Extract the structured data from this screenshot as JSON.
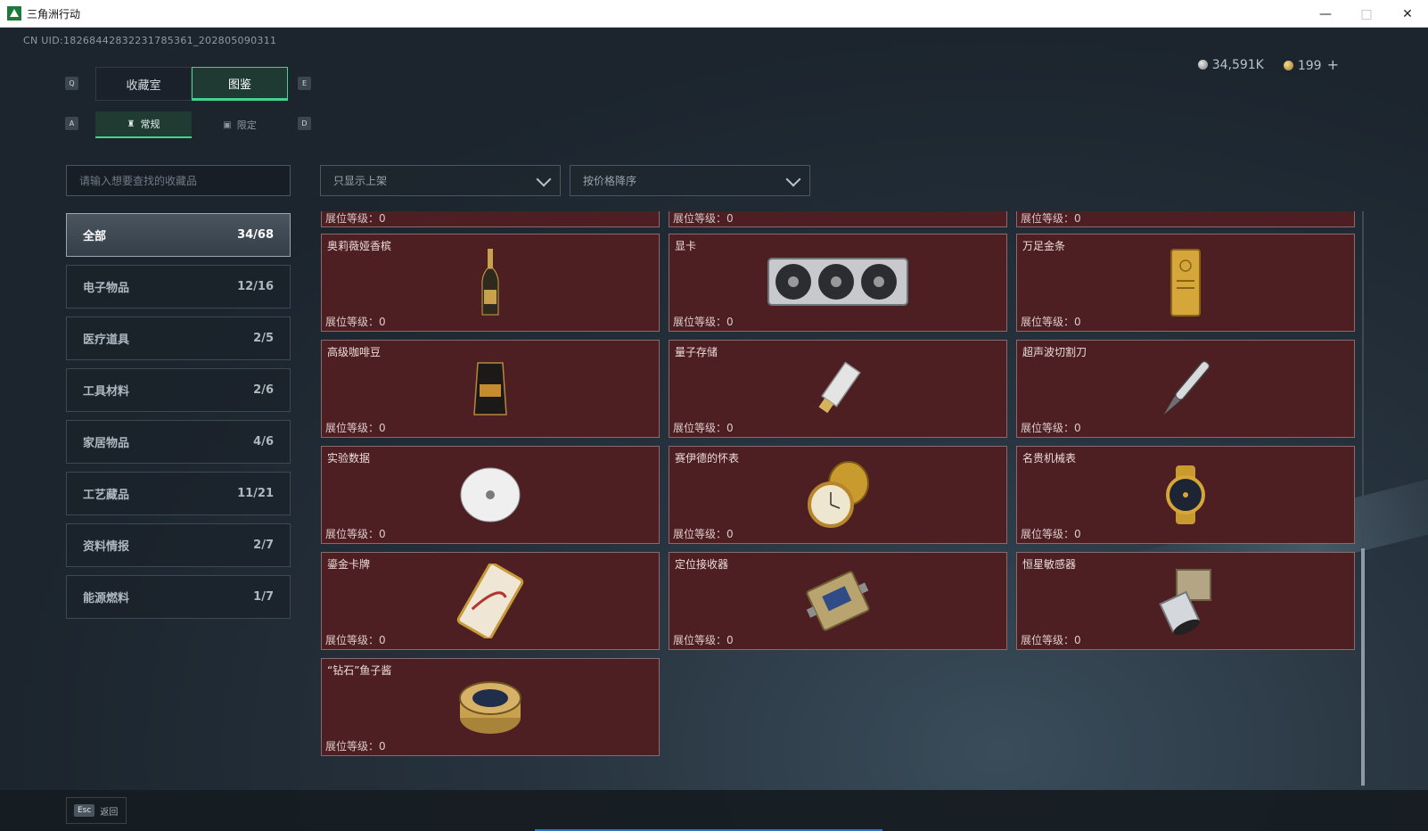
{
  "window": {
    "title": "三角洲行动",
    "minimize": "—",
    "maximize": "□",
    "close": "✕"
  },
  "uid": "CN UID:18268442832231785361_202805090311",
  "currency": {
    "silver": "34,591K",
    "gold": "199",
    "add": "+"
  },
  "keys": {
    "q": "Q",
    "e": "E",
    "a": "A",
    "d": "D"
  },
  "tabs": [
    {
      "label": "收藏室",
      "active": false
    },
    {
      "label": "图鉴",
      "active": true
    }
  ],
  "subtabs": [
    {
      "label": "常规",
      "active": true
    },
    {
      "label": "限定",
      "active": false
    }
  ],
  "search": {
    "placeholder": "请输入想要查找的收藏品"
  },
  "filters": {
    "show": "只显示上架",
    "sort": "按价格降序"
  },
  "categories": [
    {
      "label": "全部",
      "count": "34/68",
      "active": true
    },
    {
      "label": "电子物品",
      "count": "12/16"
    },
    {
      "label": "医疗道具",
      "count": "2/5"
    },
    {
      "label": "工具材料",
      "count": "2/6"
    },
    {
      "label": "家居物品",
      "count": "4/6"
    },
    {
      "label": "工艺藏品",
      "count": "11/21"
    },
    {
      "label": "资料情报",
      "count": "2/7"
    },
    {
      "label": "能源燃料",
      "count": "1/7"
    }
  ],
  "level_label": "展位等级：0",
  "items": [
    {
      "name": "奥莉薇娅香槟",
      "icon": "champagne-bottle"
    },
    {
      "name": "显卡",
      "icon": "graphics-card"
    },
    {
      "name": "万足金条",
      "icon": "gold-bar"
    },
    {
      "name": "高级咖啡豆",
      "icon": "coffee-bag"
    },
    {
      "name": "量子存储",
      "icon": "usb-drive"
    },
    {
      "name": "超声波切割刀",
      "icon": "cutting-knife"
    },
    {
      "name": "实验数据",
      "icon": "disc"
    },
    {
      "name": "赛伊德的怀表",
      "icon": "pocket-watch"
    },
    {
      "name": "名贵机械表",
      "icon": "wrist-watch"
    },
    {
      "name": "鎏金卡牌",
      "icon": "gold-card"
    },
    {
      "name": "定位接收器",
      "icon": "gps-receiver"
    },
    {
      "name": "恒星敏感器",
      "icon": "star-sensor"
    },
    {
      "name": "“钻石”鱼子酱",
      "icon": "caviar-tin"
    }
  ],
  "bottom": {
    "esc": "Esc",
    "back": "返回"
  }
}
